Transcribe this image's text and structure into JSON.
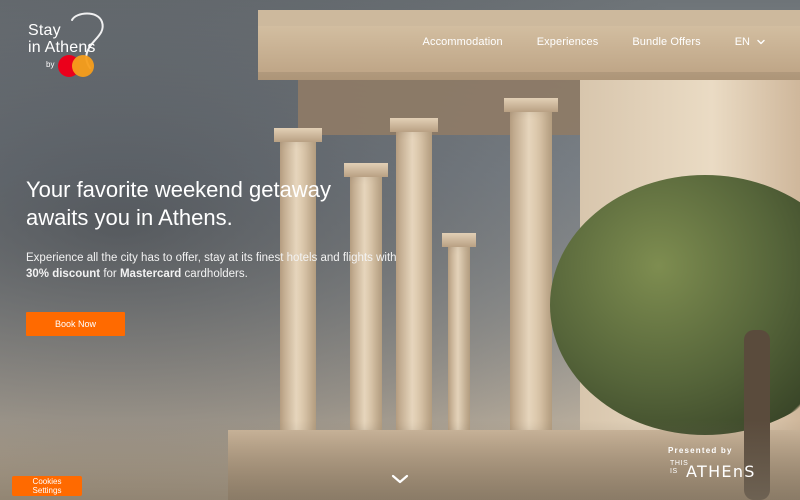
{
  "logo": {
    "line1": "Stay",
    "line2": "in Athens",
    "line3": "by",
    "badge_colors": {
      "left": "#eb001b",
      "right": "#f79e1b"
    }
  },
  "nav": {
    "items": [
      {
        "label": "Accommodation"
      },
      {
        "label": "Experiences"
      },
      {
        "label": "Bundle Offers"
      }
    ],
    "language": {
      "label": "EN"
    }
  },
  "hero": {
    "title_line1": "Your favorite weekend getaway",
    "title_line2": "awaits you in Athens.",
    "body_prefix": "Experience all the city has to offer, stay at its finest hotels and flights with",
    "body_bold1": "30% discount",
    "body_mid": "for",
    "body_bold2": "Mastercard",
    "body_suffix": "cardholders.",
    "cta": "Book Now"
  },
  "footer": {
    "cookies_button": "Cookies Settings",
    "presented_by": "Presented by",
    "brand_small_top": "THIS",
    "brand_small_bottom": "IS",
    "brand_main": "ATHEnS"
  },
  "icons": {
    "chevron": "chevron-down-icon"
  },
  "colors": {
    "accent": "#ff6a00"
  }
}
